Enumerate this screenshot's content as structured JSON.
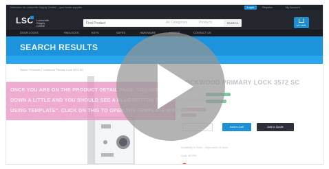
{
  "topbar": {
    "text": "Welcome to Locksmith Supply Centre – your trade supplier",
    "badge": "Login",
    "links": [
      "Register",
      "My Account"
    ]
  },
  "header": {
    "logo": "LSC",
    "logo_sub": "Locksmith Supply Centre",
    "search_placeholder": "Find Product",
    "search_category": "All Categories",
    "search_products": "Products",
    "search_button": "SEARCH",
    "cart_label": "MY CART"
  },
  "nav": {
    "items": [
      "DOOR LOCKS",
      "PADLOCKS",
      "KEYS",
      "SAFES",
      "HARDWARE",
      "ACCESS",
      "CONTACT US"
    ]
  },
  "results": {
    "title": "SEARCH RESULTS"
  },
  "breadcrumb": "Home  /  Products  /  Lockwood Primary Lock 3572 SC",
  "product": {
    "title": "LOCKWOOD PRIMARY LOCK 3572 SC",
    "add_to_cart": "Add to Cart",
    "add_to_quote": "Add to Quote",
    "info_lines": [
      "Availability: In Stock – Ships within 24 hours",
      "Code: 3572SC"
    ]
  },
  "banner": {
    "lines": [
      "ONCE YOU ARE ON THE PRODUCT DETAIL PAGE, YOU NEED TO SCROLL",
      "DOWN A LITTLE AND YOU SHOULD SEE A BLUE BUTTON THAT SAYS \"ORDER",
      "USING TEMPLATE\". CLICK ON THIS TO OPEN THE TEMPLATE WINDOW"
    ]
  },
  "colors": {
    "accent": "#1c94dd",
    "banner": "#e88cbe",
    "header": "#24272e"
  },
  "overlay": {
    "icon": "play-icon"
  }
}
